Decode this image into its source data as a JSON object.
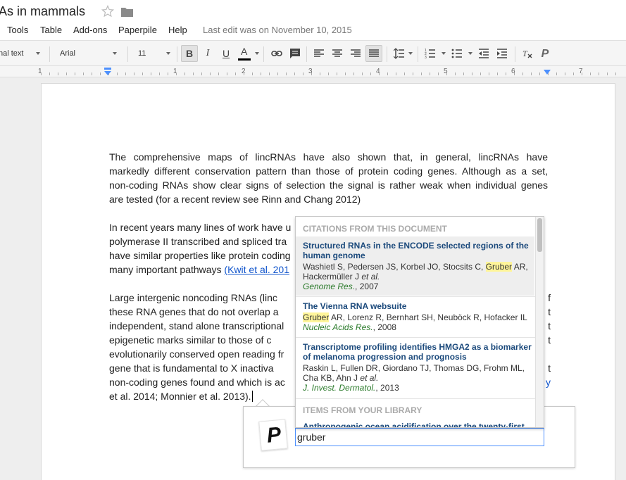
{
  "title": {
    "doc_title": "As in mammals"
  },
  "menu": {
    "items": [
      "Tools",
      "Table",
      "Add-ons",
      "Paperpile",
      "Help"
    ],
    "last_edit": "Last edit was on November 10, 2015"
  },
  "toolbar": {
    "style": "nal text",
    "font": "Arial",
    "size": "11",
    "bold": "B",
    "italic": "I",
    "underline": "U",
    "text_color": "A"
  },
  "ruler": {
    "numbers": [
      "1",
      "1",
      "2",
      "3",
      "4",
      "5",
      "6",
      "7"
    ]
  },
  "document": {
    "p1": [
      "The comprehensive maps of lincRNAs have also shown that, in general, lincRNAs have",
      "markedly different conservation pattern than those of protein coding genes. Although as a set,",
      "non-coding RNAs show clear signs of selection the signal is rather weak when individual genes",
      "are tested (for a recent review see Rinn and Chang 2012)"
    ],
    "p2": [
      "In recent years many lines of work have u",
      "polymerase II transcribed and spliced tra",
      "have similar properties like protein coding",
      "many important pathways "
    ],
    "p2_link": "(Kwit et al. 201",
    "p3": [
      "Large intergenic noncoding RNAs (linc",
      "these RNA genes that do not overlap a",
      "independent, stand alone transcriptional",
      "epigenetic marks similar to those of c",
      "evolutionarily conserved open reading fr",
      "gene that is fundamental to X inactiva",
      "non-coding genes found and which is ac",
      "et al. 2014; Monnier et al. 2013)."
    ],
    "p3_right": [
      "f",
      "t",
      "t",
      "t",
      "",
      "t",
      "y"
    ]
  },
  "paperpile": {
    "logo": "P",
    "search_value": "gruber",
    "section_document": "CITATIONS FROM THIS DOCUMENT",
    "section_library": "ITEMS FROM YOUR LIBRARY",
    "results": [
      {
        "title": "Structured RNAs in the ENCODE selected regions of the human genome",
        "authors_pre": "Washietl S, Pedersen JS, Korbel JO, Stocsits C, ",
        "authors_match": "Gruber",
        "authors_post": " AR, Hackermüller J ",
        "etal": "et al.",
        "journal": "Genome Res.",
        "year": ", 2007"
      },
      {
        "title": "The Vienna RNA websuite",
        "authors_pre": "",
        "authors_match": "Gruber",
        "authors_post": " AR, Lorenz R, Bernhart SH, Neuböck R, Hofacker IL",
        "etal": "",
        "journal": "Nucleic Acids Res.",
        "year": ", 2008"
      },
      {
        "title": "Transcriptome profiling identifies HMGA2 as a biomarker of melanoma progression and prognosis",
        "authors_pre": "Raskin L, Fullen DR, Giordano TJ, Thomas DG, Frohm ML, Cha KB, Ahn J ",
        "authors_match": "",
        "authors_post": "",
        "etal": "et al.",
        "journal": "J. Invest. Dermatol.",
        "year": ", 2013"
      }
    ],
    "library_first": "Anthropogenic ocean acidification over the twenty-first"
  },
  "colors": {
    "link": "#1155cc",
    "highlight": "#fff59a",
    "result_title": "#1c4a7c",
    "journal": "#2a7a2a",
    "focus_border": "#4d90fe"
  }
}
